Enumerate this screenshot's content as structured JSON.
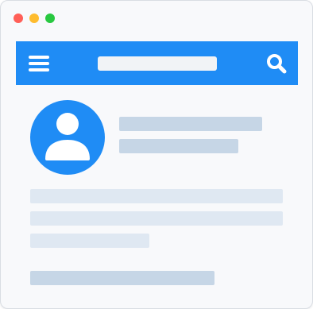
{
  "window": {
    "controls": [
      {
        "name": "close",
        "color": "#ff5f57"
      },
      {
        "name": "minimize",
        "color": "#febc2e"
      },
      {
        "name": "maximize",
        "color": "#28c840"
      }
    ]
  },
  "navbar": {
    "background": "#1f8cf5",
    "menu_icon": "hamburger-menu-icon",
    "search_icon": "search-icon",
    "search": {
      "value": "",
      "placeholder": ""
    }
  },
  "profile": {
    "avatar_icon": "user-avatar-icon",
    "avatar_color": "#1f8cf5"
  },
  "colors": {
    "placeholder_dark": "#c6d6e6",
    "placeholder_light": "#dfe8f2"
  }
}
